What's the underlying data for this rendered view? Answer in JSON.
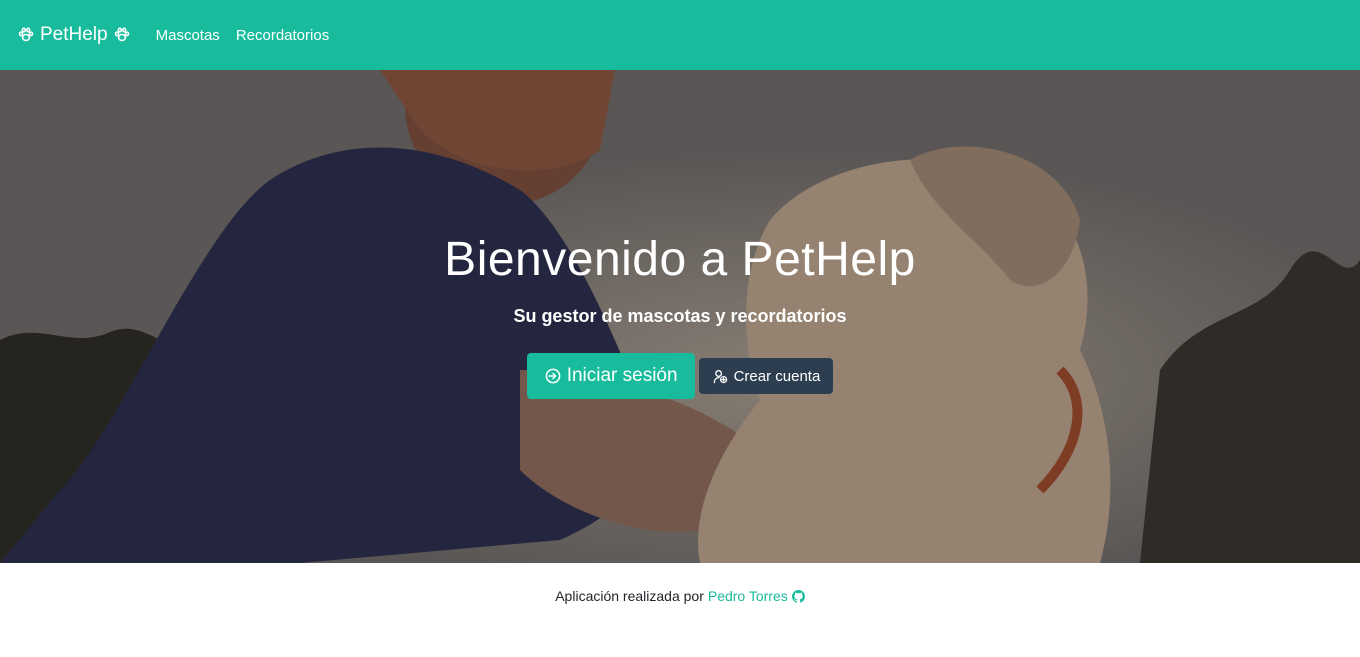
{
  "navbar": {
    "brand": "PetHelp",
    "brand_icon": "paw-icon",
    "links": [
      "Mascotas",
      "Recordatorios"
    ],
    "background": "#18bc9c"
  },
  "hero": {
    "title": "Bienvenido a PetHelp",
    "subtitle": "Su gestor de mascotas y recordatorios",
    "login_label": "Iniciar sesión",
    "login_icon": "sign-in-icon",
    "register_label": "Crear cuenta",
    "register_icon": "user-plus-icon",
    "login_color": "#18bc9c",
    "register_color": "#2c3e50"
  },
  "footer": {
    "text": "Aplicación realizada por",
    "author": "Pedro Torres",
    "author_icon": "github-icon"
  }
}
